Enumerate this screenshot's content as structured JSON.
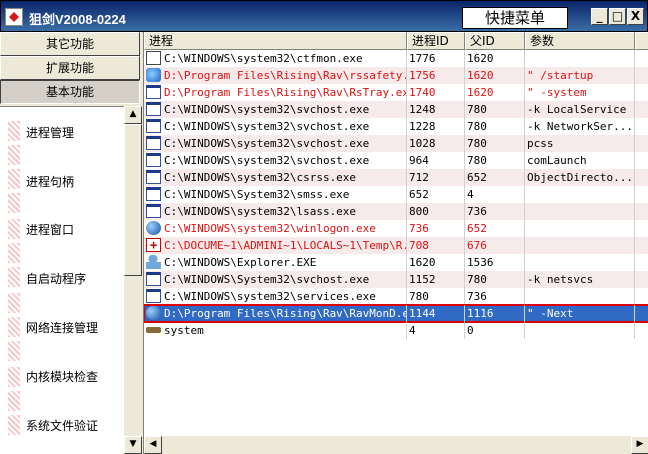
{
  "titlebar": {
    "title": "狙剑V2008-0224",
    "quick_menu": "快捷菜单",
    "min": "_",
    "max": "□",
    "close": "X"
  },
  "tabs": [
    "其它功能",
    "扩展功能",
    "基本功能"
  ],
  "functions": [
    "进程管理",
    "进程句柄",
    "进程窗口",
    "自启动程序",
    "网络连接管理",
    "内核模块检查",
    "系统文件验证"
  ],
  "table": {
    "columns": [
      "进程",
      "进程ID",
      "父ID",
      "参数"
    ],
    "rows": [
      {
        "icon": "doc",
        "path": "C:\\WINDOWS\\system32\\ctfmon.exe",
        "pid": "1776",
        "ppid": "1620",
        "args": "",
        "red": false
      },
      {
        "icon": "rav",
        "path": "D:\\Program Files\\Rising\\Rav\\rssafety...",
        "pid": "1756",
        "ppid": "1620",
        "args": "\" /startup",
        "red": true
      },
      {
        "icon": "win",
        "path": "D:\\Program Files\\Rising\\Rav\\RsTray.exe",
        "pid": "1740",
        "ppid": "1620",
        "args": "\" -system",
        "red": true
      },
      {
        "icon": "win",
        "path": "C:\\WINDOWS\\system32\\svchost.exe",
        "pid": "1248",
        "ppid": "780",
        "args": "-k LocalService",
        "red": false
      },
      {
        "icon": "win",
        "path": "C:\\WINDOWS\\system32\\svchost.exe",
        "pid": "1228",
        "ppid": "780",
        "args": "-k NetworkSer...",
        "red": false
      },
      {
        "icon": "win",
        "path": "C:\\WINDOWS\\system32\\svchost.exe",
        "pid": "1028",
        "ppid": "780",
        "args": "pcss",
        "red": false
      },
      {
        "icon": "win",
        "path": "C:\\WINDOWS\\system32\\svchost.exe",
        "pid": "964",
        "ppid": "780",
        "args": "comLaunch",
        "red": false
      },
      {
        "icon": "win",
        "path": "C:\\WINDOWS\\system32\\csrss.exe",
        "pid": "712",
        "ppid": "652",
        "args": "ObjectDirecto...",
        "red": false
      },
      {
        "icon": "win",
        "path": "C:\\WINDOWS\\System32\\smss.exe",
        "pid": "652",
        "ppid": "4",
        "args": "",
        "red": false
      },
      {
        "icon": "win",
        "path": "C:\\WINDOWS\\system32\\lsass.exe",
        "pid": "800",
        "ppid": "736",
        "args": "",
        "red": false
      },
      {
        "icon": "globe",
        "path": "C:\\WINDOWS\\system32\\winlogon.exe",
        "pid": "736",
        "ppid": "652",
        "args": "",
        "red": true
      },
      {
        "icon": "red",
        "path": "C:\\DOCUME~1\\ADMINI~1\\LOCALS~1\\Temp\\R...",
        "pid": "708",
        "ppid": "676",
        "args": "",
        "red": true
      },
      {
        "icon": "user",
        "path": "C:\\WINDOWS\\Explorer.EXE",
        "pid": "1620",
        "ppid": "1536",
        "args": "",
        "red": false
      },
      {
        "icon": "win",
        "path": "C:\\WINDOWS\\System32\\svchost.exe",
        "pid": "1152",
        "ppid": "780",
        "args": "-k netsvcs",
        "red": false
      },
      {
        "icon": "win",
        "path": "C:\\WINDOWS\\system32\\services.exe",
        "pid": "780",
        "ppid": "736",
        "args": "",
        "red": false
      },
      {
        "icon": "globe",
        "path": "D:\\Program Files\\Rising\\Rav\\RavMonD.exe",
        "pid": "1144",
        "ppid": "1116",
        "args": "\" -Next",
        "red": false,
        "selected": true
      },
      {
        "icon": "sys",
        "path": "system",
        "pid": "4",
        "ppid": "0",
        "args": "",
        "red": false
      }
    ]
  },
  "scroll_arrows": {
    "up": "▲",
    "down": "▼",
    "left": "◀",
    "right": "▶"
  }
}
